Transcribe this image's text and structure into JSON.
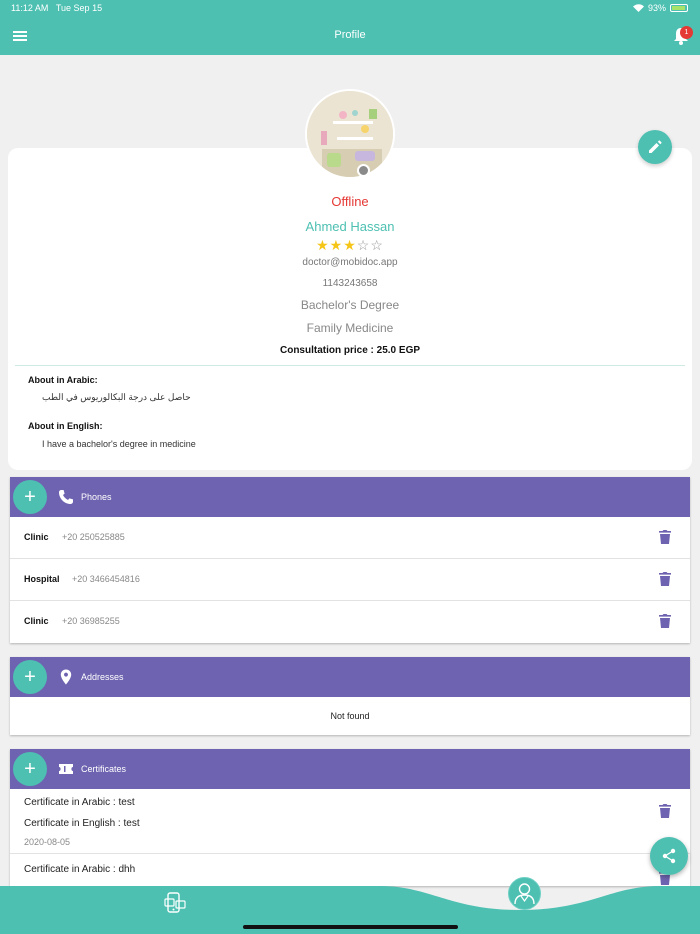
{
  "status_bar": {
    "time": "11:12 AM",
    "date": "Tue Sep 15",
    "battery": "93%"
  },
  "header": {
    "title": "Profile",
    "notification_count": "1"
  },
  "profile": {
    "status": "Offline",
    "name": "Ahmed Hassan",
    "rating": 3,
    "rating_max": 5,
    "stars_on": "★★★",
    "stars_off": "☆☆",
    "email": "doctor@mobidoc.app",
    "phone": "1143243658",
    "degree": "Bachelor's Degree",
    "specialty": "Family Medicine",
    "consultation_price": "Consultation price  : 25.0 EGP",
    "about_arabic_label": "About in Arabic:",
    "about_arabic_text": "حاصل على درجة البكالوريوس في الطب",
    "about_english_label": "About in English:",
    "about_english_text": "I have a bachelor's degree in medicine"
  },
  "phones": {
    "title": "Phones",
    "add_label": "+",
    "items": [
      {
        "type": "Clinic",
        "number": "+20 250525885"
      },
      {
        "type": "Hospital",
        "number": "+20 3466454816"
      },
      {
        "type": "Clinic",
        "number": "+20 36985255"
      }
    ]
  },
  "addresses": {
    "title": "Addresses",
    "add_label": "+",
    "empty_text": "Not found"
  },
  "certificates": {
    "title": "Certificates",
    "add_label": "+",
    "items": [
      {
        "arabic": "Certificate in Arabic : test",
        "english": "Certificate in English : test",
        "date": "2020-08-05"
      },
      {
        "arabic": "Certificate in Arabic : dhh"
      }
    ]
  },
  "colors": {
    "teal": "#4dc0b2",
    "purple": "#6e63b0",
    "offline": "#e53935",
    "star": "#f5c518"
  },
  "icons": [
    "menu-icon",
    "bell-icon",
    "edit-icon",
    "phone-icon",
    "location-icon",
    "certificate-icon",
    "trash-icon",
    "share-icon",
    "consultations-icon",
    "doctor-icon"
  ]
}
